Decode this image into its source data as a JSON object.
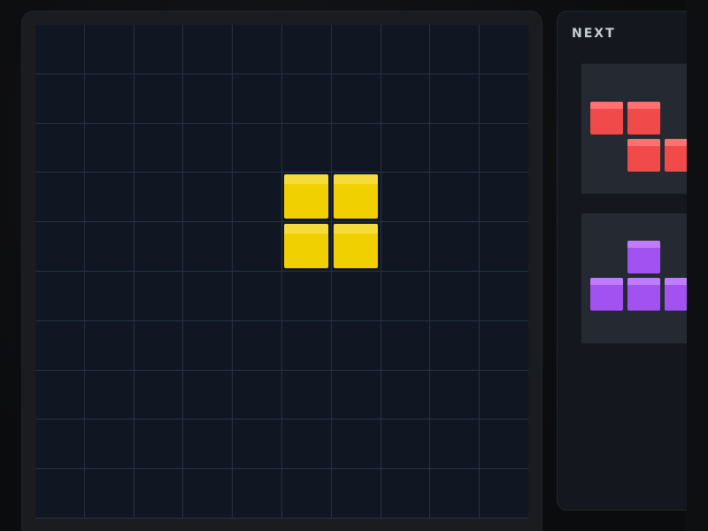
{
  "game": {
    "board": {
      "columns": 10,
      "rows": 10,
      "background_color": "#101723",
      "grid_color": "#263141",
      "active_piece": {
        "shape": "O",
        "color": "#f0d000",
        "highlight_color": "#f5dc3a",
        "cells": [
          {
            "col": 5,
            "row": 3
          },
          {
            "col": 6,
            "row": 3
          },
          {
            "col": 5,
            "row": 4
          },
          {
            "col": 6,
            "row": 4
          }
        ]
      }
    },
    "next_panel": {
      "title": "NEXT",
      "previews": [
        {
          "shape": "Z",
          "color": "#f04a4a",
          "highlight_color": "#ff7070",
          "cells": [
            {
              "col": 0,
              "row": 0
            },
            {
              "col": 1,
              "row": 0
            },
            {
              "col": 1,
              "row": 1
            },
            {
              "col": 2,
              "row": 1
            }
          ]
        },
        {
          "shape": "T",
          "color": "#a252f0",
          "highlight_color": "#c07cff",
          "cells": [
            {
              "col": 1,
              "row": 0
            },
            {
              "col": 0,
              "row": 1
            },
            {
              "col": 1,
              "row": 1
            },
            {
              "col": 2,
              "row": 1
            }
          ]
        }
      ]
    }
  }
}
